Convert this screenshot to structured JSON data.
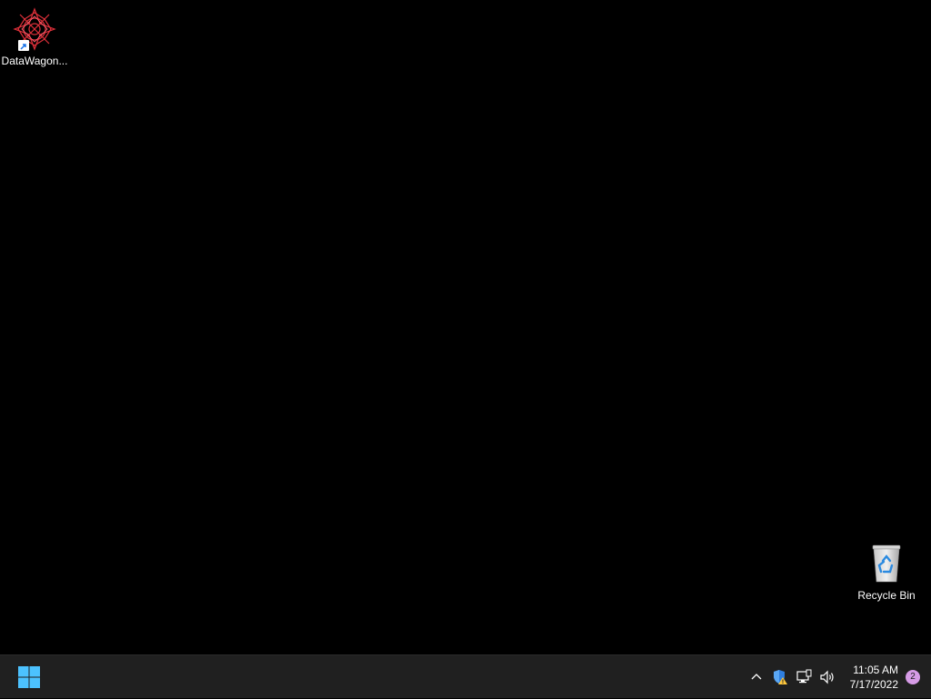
{
  "desktop": {
    "background_color": "#000000",
    "icons": [
      {
        "label": "DataWagon...",
        "icon": "datawagon-app-icon",
        "shortcut": true
      },
      {
        "label": "Recycle Bin",
        "icon": "recycle-bin-icon",
        "shortcut": false
      }
    ]
  },
  "taskbar": {
    "background_color": "#202020",
    "start_icon": "windows-start-icon",
    "tray": {
      "icons": [
        "chevron-up-icon",
        "security-shield-warning-icon",
        "network-icon",
        "volume-icon"
      ],
      "time": "11:05 AM",
      "date": "7/17/2022",
      "notification_count": "2"
    }
  },
  "colors": {
    "accent": "#4cc2ff",
    "notification_badge": "#d69be6"
  }
}
